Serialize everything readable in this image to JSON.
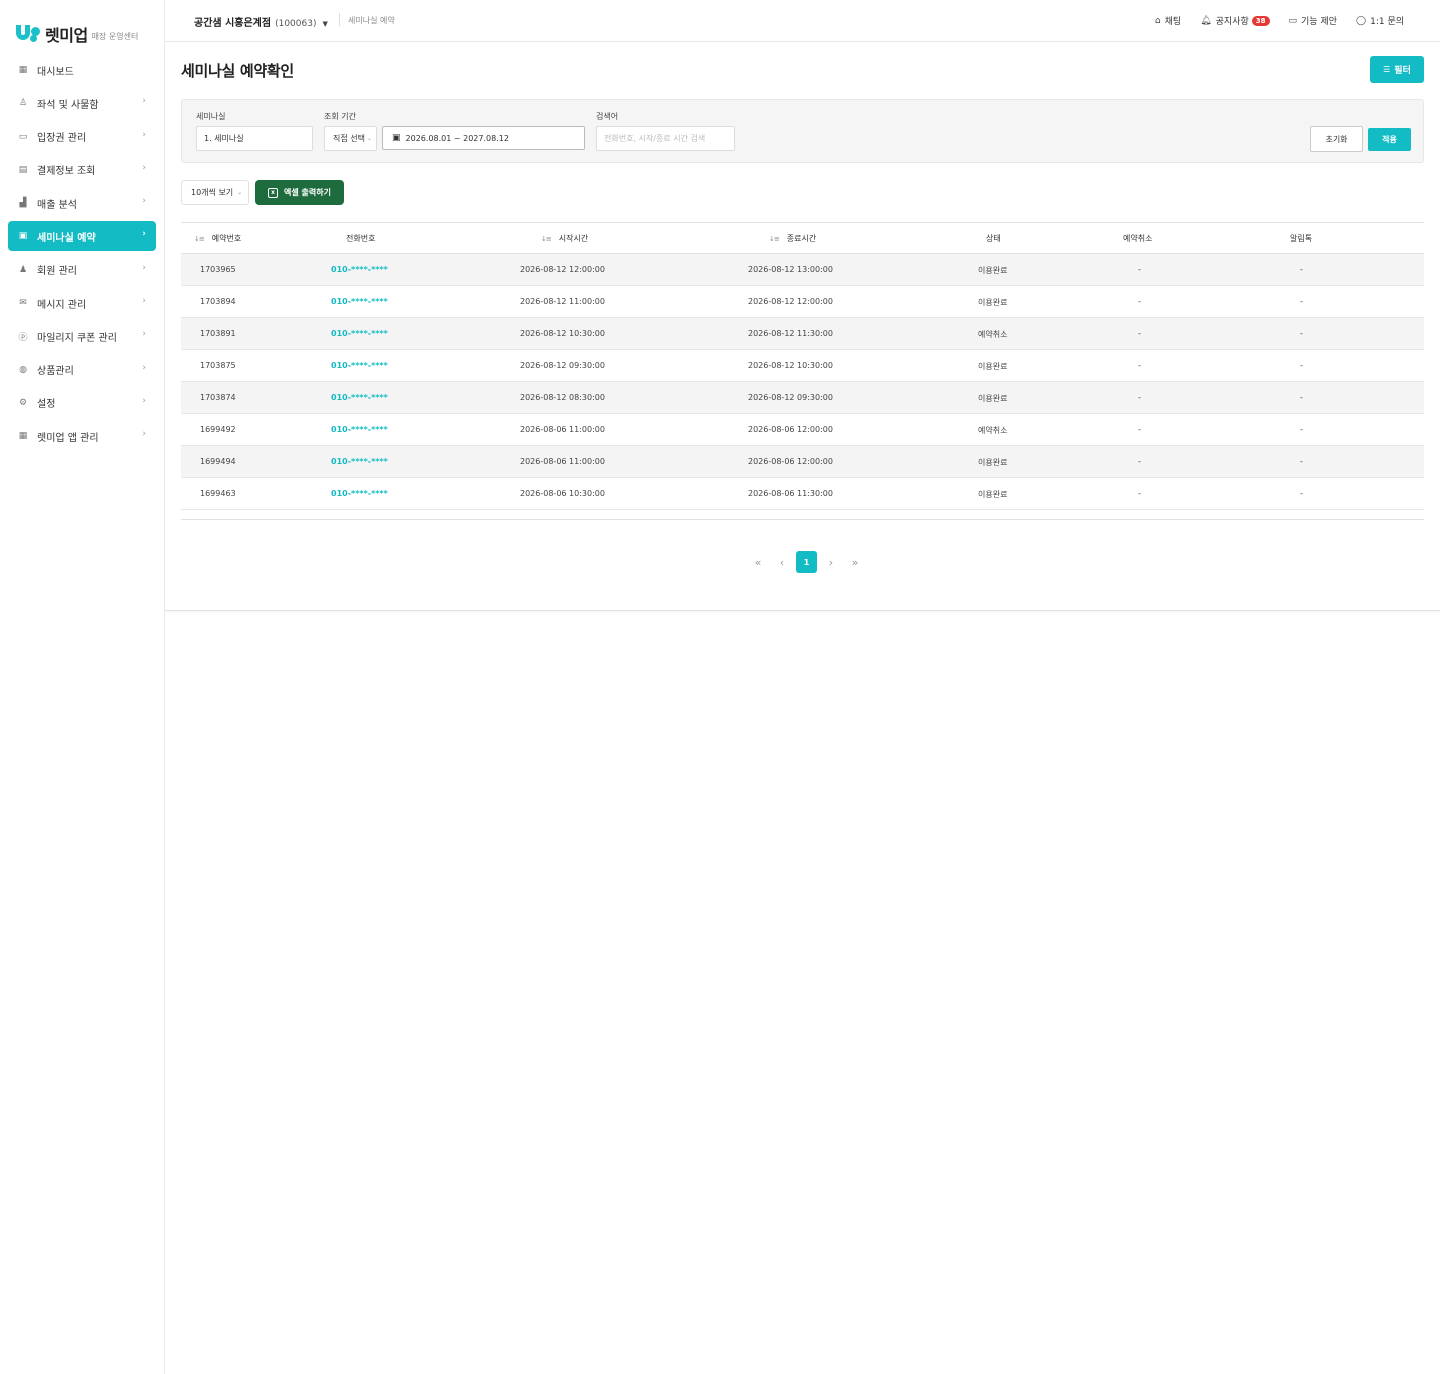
{
  "brand": {
    "name": "렛미업",
    "subtitle": "매장 운영센터",
    "accent": "#13bcc4"
  },
  "sidebar": {
    "items": [
      {
        "label": "대시보드",
        "icon": "grid-icon",
        "glyph": "▦",
        "chevron": false,
        "active": false
      },
      {
        "label": "좌석 및 사물함",
        "icon": "seat-icon",
        "glyph": "♙",
        "chevron": true,
        "active": false
      },
      {
        "label": "입장권 관리",
        "icon": "ticket-icon",
        "glyph": "▭",
        "chevron": true,
        "active": false
      },
      {
        "label": "결제정보 조회",
        "icon": "card-icon",
        "glyph": "▤",
        "chevron": true,
        "active": false
      },
      {
        "label": "매출 분석",
        "icon": "bar-chart-icon",
        "glyph": "▟",
        "chevron": true,
        "active": false
      },
      {
        "label": "세미나실 예약",
        "icon": "calendar-icon",
        "glyph": "▣",
        "chevron": true,
        "active": true
      },
      {
        "label": "회원 관리",
        "icon": "users-icon",
        "glyph": "♟",
        "chevron": true,
        "active": false
      },
      {
        "label": "메시지 관리",
        "icon": "mail-icon",
        "glyph": "✉",
        "chevron": true,
        "active": false
      },
      {
        "label": "마일리지 쿠폰 관리",
        "icon": "coin-icon",
        "glyph": "ⓟ",
        "chevron": true,
        "active": false
      },
      {
        "label": "상품관리",
        "icon": "box-icon",
        "glyph": "◍",
        "chevron": true,
        "active": false
      },
      {
        "label": "설정",
        "icon": "gear-icon",
        "glyph": "⚙",
        "chevron": true,
        "active": false
      },
      {
        "label": "렛미업 앱 관리",
        "icon": "apps-icon",
        "glyph": "▦",
        "chevron": true,
        "active": false
      }
    ]
  },
  "header": {
    "store_name": "공간샘 시흥은계점",
    "store_code": "(100063)",
    "breadcrumb": "세미나실 예약",
    "links": {
      "chat": "채팅",
      "notice": "공지사항",
      "notice_count": "38",
      "suggest": "기능 제안",
      "inquiry": "1:1 문의"
    }
  },
  "main": {
    "title": "세미나실 예약확인",
    "filter_button": "필터",
    "filters": {
      "room_label": "세미나실",
      "room_value": "1. 세미나실",
      "period_label": "조회 기간",
      "period_mode": "직접 선택",
      "date_range": "2026.08.01 ~ 2027.08.12",
      "search_label": "검색어",
      "search_placeholder": "전화번호, 시작/종료 시간 검색",
      "reset": "초기화",
      "apply": "적용"
    },
    "page_size": "10개씩 보기",
    "excel_button": "엑셀 출력하기"
  },
  "table": {
    "columns": [
      "예약번호",
      "전화번호",
      "시작시간",
      "종료시간",
      "상태",
      "예약취소",
      "알림톡"
    ],
    "rows": [
      [
        "1703965",
        "010-****-****",
        "2026-08-12 12:00:00",
        "2026-08-12 13:00:00",
        "이용완료",
        "-",
        "-"
      ],
      [
        "1703894",
        "010-****-****",
        "2026-08-12 11:00:00",
        "2026-08-12 12:00:00",
        "이용완료",
        "-",
        "-"
      ],
      [
        "1703891",
        "010-****-****",
        "2026-08-12 10:30:00",
        "2026-08-12 11:30:00",
        "예약취소",
        "-",
        "-"
      ],
      [
        "1703875",
        "010-****-****",
        "2026-08-12 09:30:00",
        "2026-08-12 10:30:00",
        "이용완료",
        "-",
        "-"
      ],
      [
        "1703874",
        "010-****-****",
        "2026-08-12 08:30:00",
        "2026-08-12 09:30:00",
        "이용완료",
        "-",
        "-"
      ],
      [
        "1699492",
        "010-****-****",
        "2026-08-06 11:00:00",
        "2026-08-06 12:00:00",
        "예약취소",
        "-",
        "-"
      ],
      [
        "1699494",
        "010-****-****",
        "2026-08-06 11:00:00",
        "2026-08-06 12:00:00",
        "이용완료",
        "-",
        "-"
      ],
      [
        "1699463",
        "010-****-****",
        "2026-08-06 10:30:00",
        "2026-08-06 11:30:00",
        "이용완료",
        "-",
        "-"
      ]
    ]
  },
  "pagination": {
    "current": "1",
    "first": "«",
    "prev": "‹",
    "next": "›",
    "last": "»"
  }
}
